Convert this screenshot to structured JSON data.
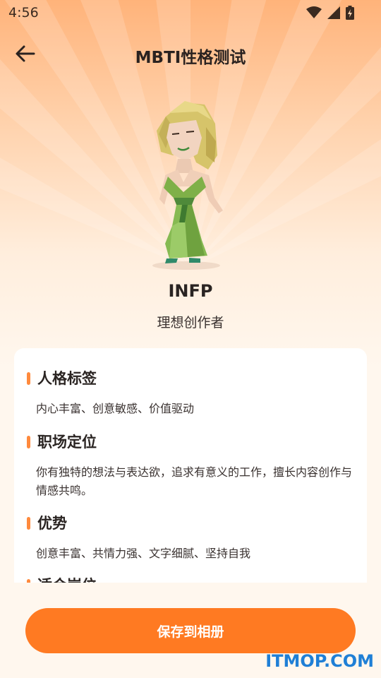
{
  "status_bar": {
    "time": "4:56",
    "icons": [
      "wifi-icon",
      "signal-icon",
      "battery-icon"
    ]
  },
  "header": {
    "back_icon": "arrow-left-icon",
    "title": "MBTI性格测试"
  },
  "profile": {
    "type": "INFP",
    "nickname": "理想创作者"
  },
  "sections": [
    {
      "heading": "人格标签",
      "text": "内心丰富、创意敏感、价值驱动"
    },
    {
      "heading": "职场定位",
      "text": "你有独特的想法与表达欲，追求有意义的工作，擅长内容创作与情感共鸣。"
    },
    {
      "heading": "优势",
      "text": "创意丰富、共情力强、文字细腻、坚持自我"
    },
    {
      "heading": "适合岗位",
      "text": ""
    }
  ],
  "actions": {
    "save_label": "保存到相册"
  },
  "watermark": "ITMOP.COM",
  "colors": {
    "accent": "#ff7a22",
    "section_bar": "#ff8a3d",
    "watermark": "#1f7fd6"
  }
}
